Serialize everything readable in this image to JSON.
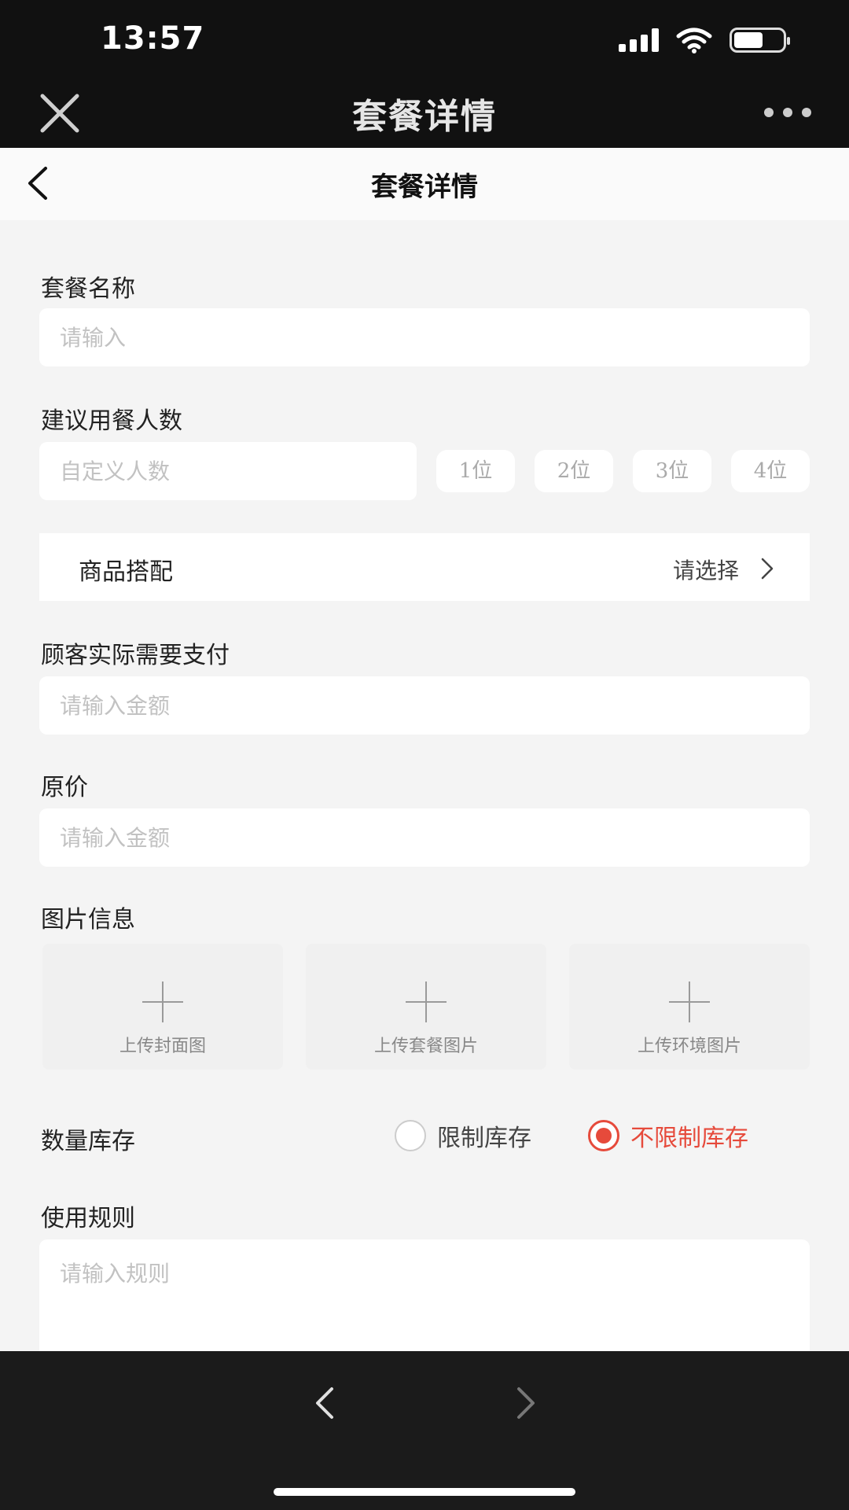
{
  "status_bar": {
    "time": "13:57"
  },
  "app_bar": {
    "title": "套餐详情"
  },
  "nav_bar": {
    "title": "套餐详情"
  },
  "form": {
    "name": {
      "label": "套餐名称",
      "placeholder": "请输入"
    },
    "party_size": {
      "label": "建议用餐人数",
      "placeholder": "自定义人数",
      "options": [
        "1位",
        "2位",
        "3位",
        "4位"
      ]
    },
    "products": {
      "label": "商品搭配",
      "value": "请选择"
    },
    "pay_amount": {
      "label": "顾客实际需要支付",
      "placeholder": "请输入金额"
    },
    "original_price": {
      "label": "原价",
      "placeholder": "请输入金额"
    },
    "images": {
      "label": "图片信息",
      "uploads": [
        "上传封面图",
        "上传套餐图片",
        "上传环境图片"
      ]
    },
    "stock": {
      "label": "数量库存",
      "options": [
        {
          "label": "限制库存",
          "selected": false
        },
        {
          "label": "不限制库存",
          "selected": true
        }
      ]
    },
    "rules": {
      "label": "使用规则",
      "placeholder": "请输入规则"
    }
  },
  "colors": {
    "accent": "#e64a3b",
    "dark_bar": "#111111",
    "page_bg": "#f4f4f4"
  }
}
